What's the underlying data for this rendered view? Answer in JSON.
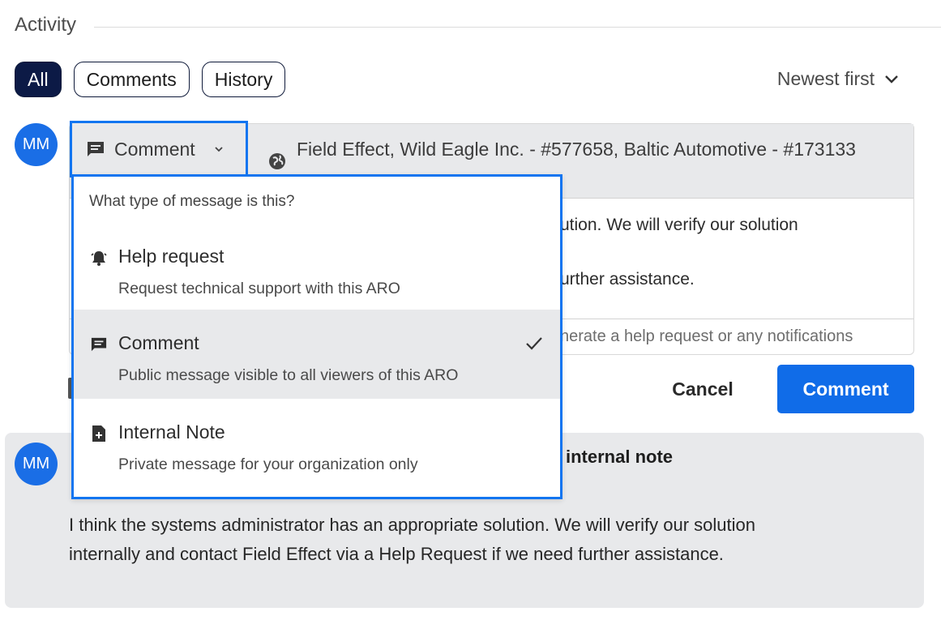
{
  "activity": {
    "title": "Activity",
    "tabs": [
      {
        "label": "All",
        "active": true
      },
      {
        "label": "Comments",
        "active": false
      },
      {
        "label": "History",
        "active": false
      }
    ],
    "sort_label": "Newest first"
  },
  "user": {
    "initials": "MM"
  },
  "composer": {
    "type_button_label": "Comment",
    "audience_text": "Field Effect, Wild Eagle Inc. - #577658, Baltic Automotive - #173133",
    "body_lines": [
      "ution. We will verify our solution",
      "urther assistance."
    ],
    "footer_hint": "nerate a help request or any notifications",
    "cancel_label": "Cancel",
    "submit_label": "Comment"
  },
  "menu": {
    "prompt": "What type of message is this?",
    "options": [
      {
        "icon": "bell-icon",
        "title": "Help request",
        "desc": "Request technical support with this ARO",
        "selected": false
      },
      {
        "icon": "comment-icon",
        "title": "Comment",
        "desc": "Public message visible to all viewers of this ARO",
        "selected": true
      },
      {
        "icon": "note-plus-icon",
        "title": "Internal Note",
        "desc": "Private message for your organization only",
        "selected": false
      }
    ]
  },
  "entry": {
    "initials": "MM",
    "label": "internal note",
    "body": "I think the systems administrator has an appropriate solution. We will verify our solution internally and contact Field Effect via a Help Request if we need further assistance."
  },
  "colors": {
    "accent": "#1275f0",
    "primary_button": "#106ce8",
    "tab_active": "#0c1a46",
    "avatar": "#1a6ee6",
    "panel_grey": "#e8e9eb"
  }
}
